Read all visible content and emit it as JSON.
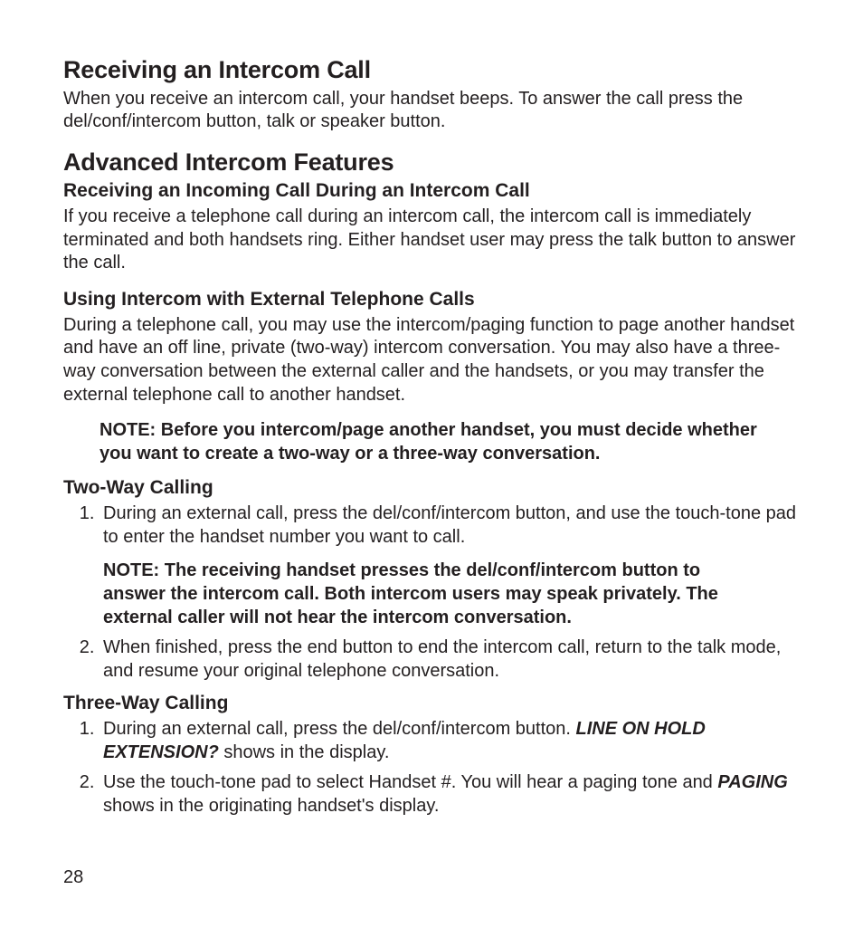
{
  "page_number": "28",
  "h1_receiving": "Receiving an Intercom Call",
  "p_receiving": "When you receive an intercom call, your handset beeps. To answer the call press the del/conf/intercom button, talk or speaker button.",
  "h1_advanced": "Advanced Intercom Features",
  "h2_incoming": "Receiving an Incoming Call During an Intercom Call",
  "p_incoming": "If you receive a telephone call during an intercom call, the intercom call is immediately terminated and both handsets ring. Either handset user may press the talk button to answer the call.",
  "h2_external": "Using Intercom with External Telephone Calls",
  "p_external": "During a telephone call, you may use the intercom/paging function to page another handset and have an off line, private (two-way) intercom conversation. You may also have a three-way conversation between the external caller and the handsets, or you may transfer the external telephone call to another handset.",
  "note_decide": "NOTE: Before you intercom/page another handset, you must decide whether you want to create a two-way or a three-way conversation.",
  "h2_twoway": "Two-Way Calling",
  "twoway_step1": "During an external call, press the del/conf/intercom button, and use the touch-tone pad to enter the handset number you want to call.",
  "note_receiving": "NOTE: The receiving handset presses the del/conf/intercom button to answer the intercom call. Both intercom users may speak privately. The external caller will not hear the intercom conversation.",
  "twoway_step2": "When finished, press the end button to end the intercom call, return to the talk mode, and resume your original telephone conversation.",
  "h2_threeway": "Three-Way Calling",
  "threeway_step1_a": "During an external call, press the del/conf/intercom button. ",
  "threeway_step1_b": "LINE ON HOLD EXTENSION?",
  "threeway_step1_c": " shows in the display.",
  "threeway_step2_a": "Use the touch-tone pad to select Handset #. You will hear a paging tone and ",
  "threeway_step2_b": "PAGING",
  "threeway_step2_c": " shows in the originating handset's display."
}
